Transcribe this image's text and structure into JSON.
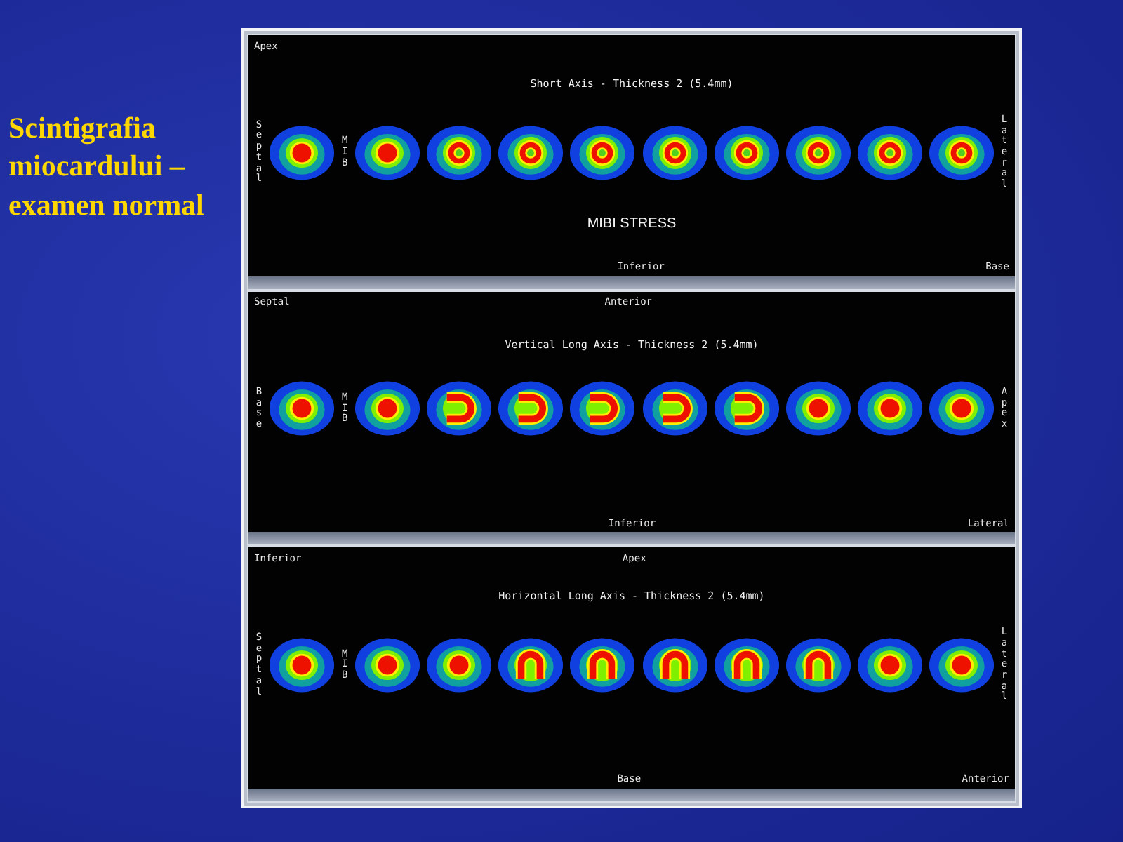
{
  "caption": "Scintigrafia miocardului – examen normal",
  "panels": [
    {
      "top_left": "Apex",
      "title": "Short Axis - Thickness 2 (5.4mm)",
      "left_side": "Septal",
      "marker": "MIB",
      "right_side": "Lateral",
      "subtitle": "MIBI STRESS",
      "bottom_center": "Inferior",
      "bottom_right": "Base",
      "slices": [
        {
          "kind": "solid"
        },
        {
          "kind": "solid"
        },
        {
          "kind": "ring"
        },
        {
          "kind": "ring"
        },
        {
          "kind": "ring"
        },
        {
          "kind": "ring"
        },
        {
          "kind": "ring"
        },
        {
          "kind": "ring"
        },
        {
          "kind": "ring"
        },
        {
          "kind": "ring"
        }
      ]
    },
    {
      "top_left": "Septal",
      "top_center": "Anterior",
      "title": "Vertical Long Axis - Thickness 2 (5.4mm)",
      "left_side": "Base",
      "marker": "MIB",
      "right_side": "Apex",
      "bottom_center": "Inferior",
      "bottom_right": "Lateral",
      "slices": [
        {
          "kind": "solid"
        },
        {
          "kind": "solid"
        },
        {
          "kind": "horseshoe"
        },
        {
          "kind": "horseshoe"
        },
        {
          "kind": "horseshoe"
        },
        {
          "kind": "horseshoe"
        },
        {
          "kind": "horseshoe"
        },
        {
          "kind": "solid"
        },
        {
          "kind": "solid"
        },
        {
          "kind": "solid"
        }
      ]
    },
    {
      "top_left": "Inferior",
      "top_center": "Apex",
      "title": "Horizontal Long Axis - Thickness 2 (5.4mm)",
      "left_side": "Septal",
      "marker": "MIB",
      "right_side": "Lateral",
      "bottom_center": "Base",
      "bottom_right": "Anterior",
      "slices": [
        {
          "kind": "solid"
        },
        {
          "kind": "solid"
        },
        {
          "kind": "solid"
        },
        {
          "kind": "arch"
        },
        {
          "kind": "arch"
        },
        {
          "kind": "arch"
        },
        {
          "kind": "arch"
        },
        {
          "kind": "arch"
        },
        {
          "kind": "solid"
        },
        {
          "kind": "solid"
        }
      ]
    }
  ]
}
